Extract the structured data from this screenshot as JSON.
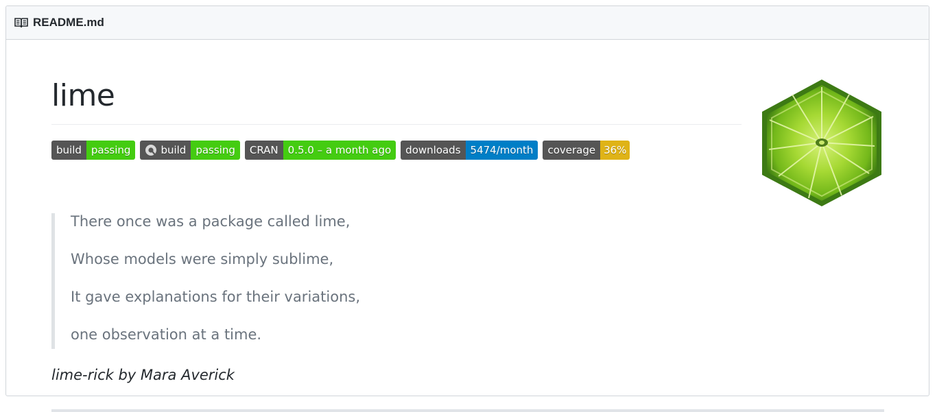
{
  "file_header": {
    "filename": "README.md",
    "icon": "book-icon"
  },
  "readme": {
    "title": "lime",
    "logo": "lime-slice-hexagon-logo",
    "badges": [
      {
        "left": "build",
        "right": "passing",
        "color": "#4c1",
        "icon": ""
      },
      {
        "left": "build",
        "right": "passing",
        "color": "#4c1",
        "icon": "appveyor-icon"
      },
      {
        "left": "CRAN",
        "right": "0.5.0 – a month ago",
        "color": "#4c1",
        "icon": ""
      },
      {
        "left": "downloads",
        "right": "5474/month",
        "color": "#007ec6",
        "icon": ""
      },
      {
        "left": "coverage",
        "right": "36%",
        "color": "#dfb317",
        "icon": ""
      }
    ],
    "quote_lines": [
      "There once was a package called lime,",
      "Whose models were simply sublime,",
      "It gave explanations for their variations,",
      "one observation at a time."
    ],
    "credit": "lime-rick by Mara Averick"
  }
}
